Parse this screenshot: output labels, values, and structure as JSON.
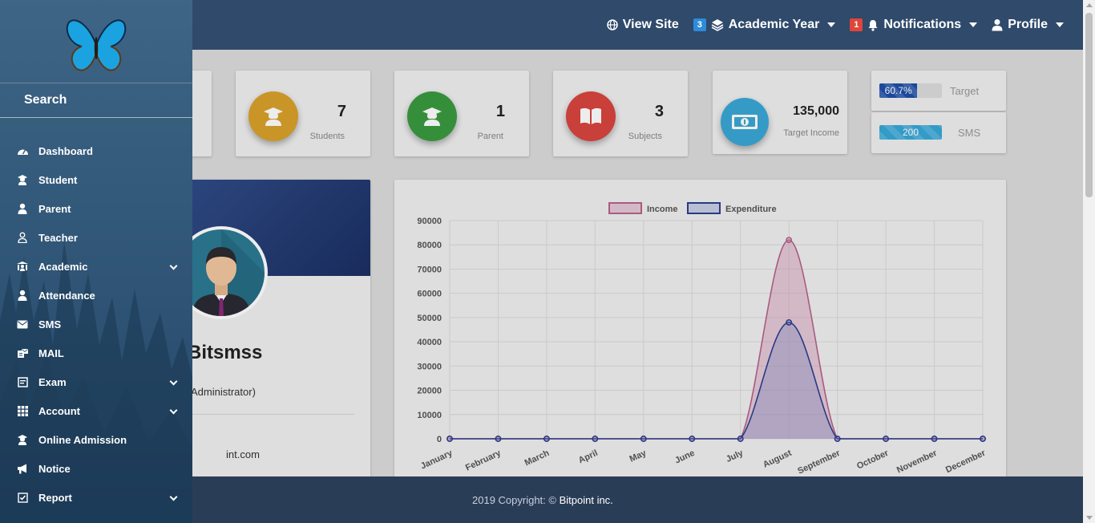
{
  "topbar": {
    "view_site": "View Site",
    "academic_year_badge": "3",
    "academic_year": "Academic Year",
    "notifications_badge": "1",
    "notifications": "Notifications",
    "profile": "Profile"
  },
  "colors": {
    "topbar": "#2f4a6b",
    "students": "#d9a12a",
    "parent": "#3a9a3f",
    "subjects": "#d9443f",
    "income": "#3aa7d6",
    "progress_target": "#1d4fa8",
    "progress_sms": "#36a7d8",
    "income_line": "#b5638a",
    "expenditure_line": "#2e3f8f"
  },
  "stats": {
    "students": {
      "value": "7",
      "label": "Students",
      "icon": "graduate-icon"
    },
    "parent": {
      "value": "1",
      "label": "Parent",
      "icon": "graduate-icon"
    },
    "subjects": {
      "value": "3",
      "label": "Subjects",
      "icon": "book-icon"
    },
    "income": {
      "value": "135,000",
      "label": "Target Income",
      "icon": "money-icon"
    }
  },
  "progress": {
    "target": {
      "value_text": "60.7%",
      "fraction": 0.607,
      "label": "Target"
    },
    "sms": {
      "value_text": "200",
      "fraction": 1.0,
      "label": "SMS"
    }
  },
  "profile_card": {
    "name": "Bitsmss",
    "role": "Administrator)",
    "email": "int.com"
  },
  "sidebar": {
    "search": "Search",
    "items": [
      {
        "label": "Dashboard",
        "icon": "dashboard-icon",
        "expandable": false
      },
      {
        "label": "Student",
        "icon": "graduate-icon",
        "expandable": false
      },
      {
        "label": "Parent",
        "icon": "user-icon",
        "expandable": false
      },
      {
        "label": "Teacher",
        "icon": "user-outline-icon",
        "expandable": false
      },
      {
        "label": "Academic",
        "icon": "academic-icon",
        "expandable": true
      },
      {
        "label": "Attendance",
        "icon": "user-icon",
        "expandable": false
      },
      {
        "label": "SMS",
        "icon": "envelope-icon",
        "expandable": false
      },
      {
        "label": "MAIL",
        "icon": "mail-icon",
        "expandable": false
      },
      {
        "label": "Exam",
        "icon": "exam-icon",
        "expandable": true
      },
      {
        "label": "Account",
        "icon": "grid-icon",
        "expandable": true
      },
      {
        "label": "Online Admission",
        "icon": "graduate-icon",
        "expandable": false
      },
      {
        "label": "Notice",
        "icon": "megaphone-icon",
        "expandable": false
      },
      {
        "label": "Report",
        "icon": "checkbox-icon",
        "expandable": true
      }
    ]
  },
  "footer": {
    "text": "2019 Copyright: © ",
    "brand": "Bitpoint inc."
  },
  "chart_data": {
    "type": "line",
    "categories": [
      "January",
      "February",
      "March",
      "April",
      "May",
      "June",
      "July",
      "August",
      "September",
      "October",
      "November",
      "December"
    ],
    "series": [
      {
        "name": "Income",
        "values": [
          0,
          0,
          0,
          0,
          0,
          0,
          0,
          82000,
          0,
          0,
          0,
          0
        ]
      },
      {
        "name": "Expenditure",
        "values": [
          0,
          0,
          0,
          0,
          0,
          0,
          0,
          48000,
          0,
          0,
          0,
          0
        ]
      }
    ],
    "yticks": [
      "0",
      "10000",
      "20000",
      "30000",
      "40000",
      "50000",
      "60000",
      "70000",
      "80000",
      "90000"
    ],
    "ylim": [
      0,
      90000
    ],
    "grid": true,
    "legend_position": "top"
  }
}
